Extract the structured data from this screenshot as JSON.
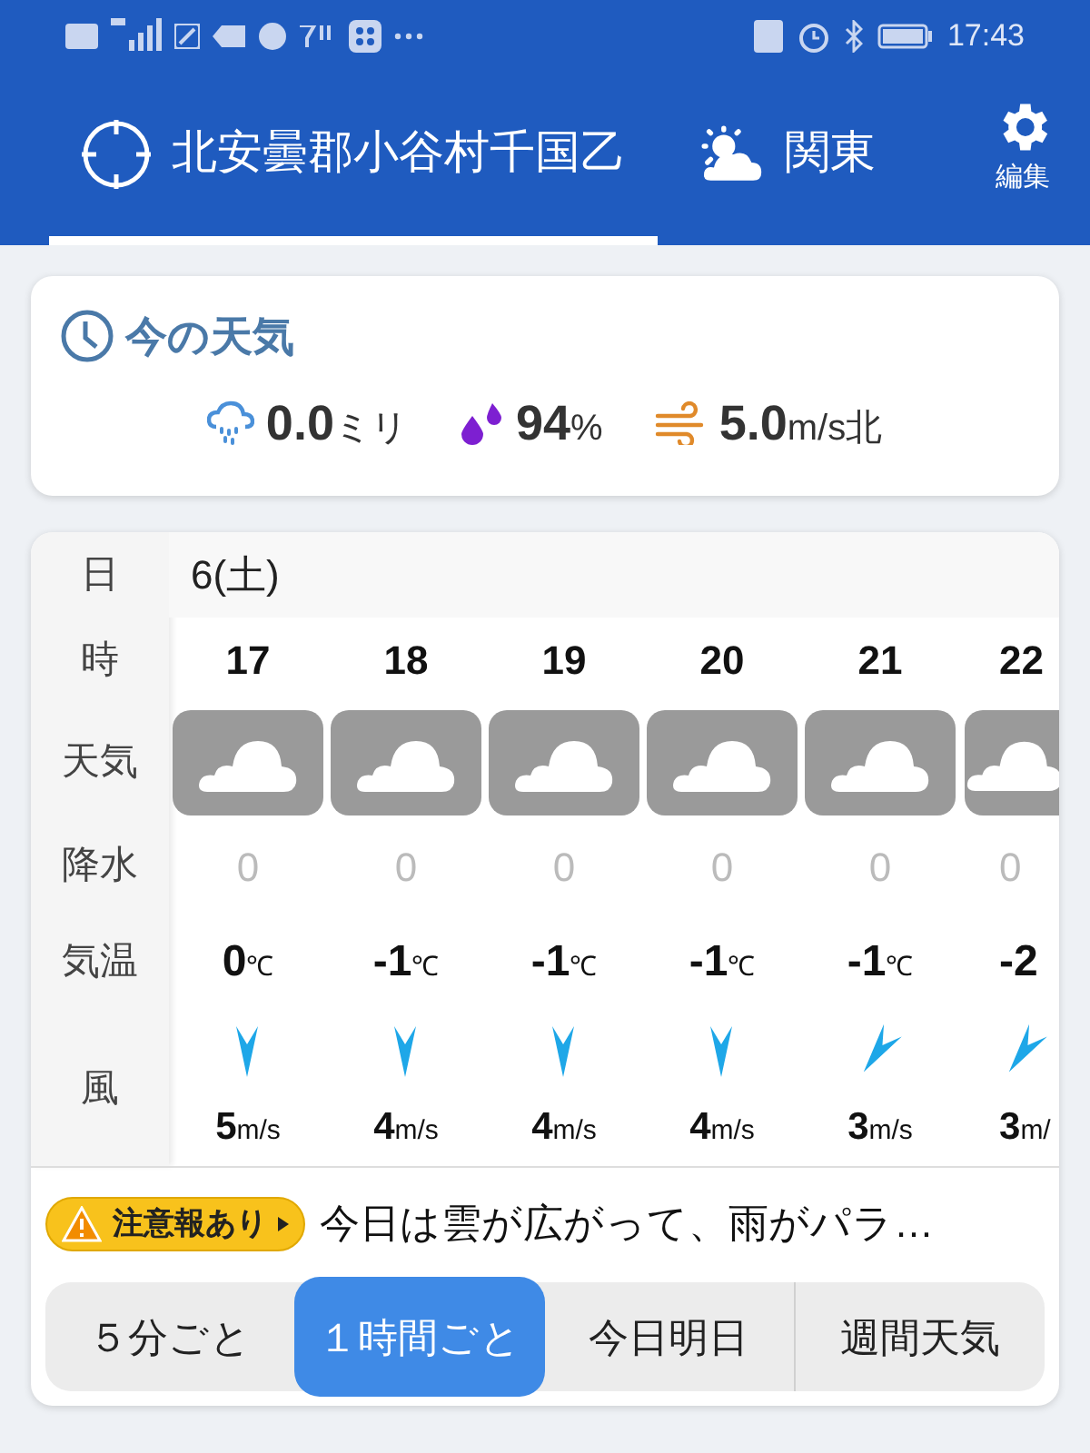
{
  "status_bar": {
    "time": "17:43"
  },
  "header": {
    "tabs": [
      {
        "kind": "location",
        "label": "北安曇郡小谷村千国乙",
        "selected": true
      },
      {
        "kind": "region",
        "label": "関東",
        "selected": false
      }
    ],
    "settings_label": "編集"
  },
  "current": {
    "title": "今の天気",
    "items": [
      {
        "kind": "rain",
        "value": "0.0",
        "unit": "ミリ"
      },
      {
        "kind": "humidity",
        "value": "94",
        "unit": "%"
      },
      {
        "kind": "wind",
        "value": "5.0",
        "unit": "m/s北"
      }
    ]
  },
  "forecast": {
    "row_labels": [
      "日",
      "時",
      "天気",
      "降水",
      "気温",
      "風"
    ],
    "date": "6(土)",
    "hours": [
      {
        "hour": "17",
        "weather": {
          "kind": "cloudy"
        },
        "precip": "0",
        "temp": "0",
        "temp_unit": "℃",
        "wind_arrow": {
          "kind": "down"
        },
        "wind": "5",
        "wind_unit": "m/s"
      },
      {
        "hour": "18",
        "weather": {
          "kind": "cloudy"
        },
        "precip": "0",
        "temp": "-1",
        "temp_unit": "℃",
        "wind_arrow": {
          "kind": "down"
        },
        "wind": "4",
        "wind_unit": "m/s"
      },
      {
        "hour": "19",
        "weather": {
          "kind": "cloudy"
        },
        "precip": "0",
        "temp": "-1",
        "temp_unit": "℃",
        "wind_arrow": {
          "kind": "down"
        },
        "wind": "4",
        "wind_unit": "m/s"
      },
      {
        "hour": "20",
        "weather": {
          "kind": "cloudy"
        },
        "precip": "0",
        "temp": "-1",
        "temp_unit": "℃",
        "wind_arrow": {
          "kind": "down"
        },
        "wind": "4",
        "wind_unit": "m/s"
      },
      {
        "hour": "21",
        "weather": {
          "kind": "cloudy"
        },
        "precip": "0",
        "temp": "-1",
        "temp_unit": "℃",
        "wind_arrow": {
          "kind": "down-left"
        },
        "wind": "3",
        "wind_unit": "m/s"
      },
      {
        "hour": "22",
        "weather": {
          "kind": "cloudy"
        },
        "precip": "0",
        "temp": "-2",
        "wind_arrow": {
          "kind": "down-left"
        },
        "wind": "3",
        "wind_unit": "m/"
      }
    ]
  },
  "alert": {
    "badge": "注意報あり",
    "text": "今日は雲が広がって、雨がパラ…"
  },
  "views": [
    {
      "label": "５分ごと",
      "selected": false
    },
    {
      "label": "１時間ごと",
      "selected": true
    },
    {
      "label": "今日明日",
      "selected": false
    },
    {
      "label": "週間天気",
      "selected": false
    }
  ]
}
